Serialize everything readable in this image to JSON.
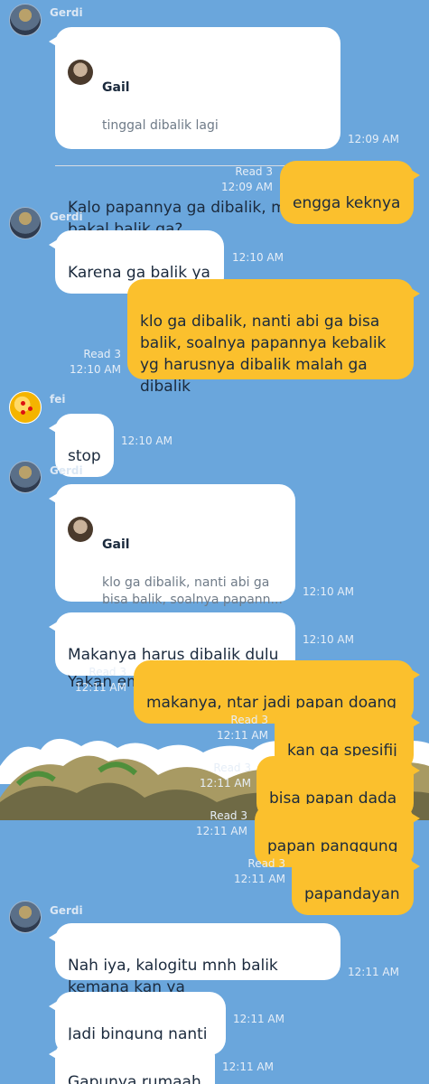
{
  "theme": {
    "background": "#6aa6dc",
    "incoming": "#ffffff",
    "outgoing": "#fbc02d"
  },
  "messages": [
    {
      "sender": "Gerdi",
      "quote_name": "Gail",
      "quote_text": "tinggal dibalik lagi",
      "text": "Kalo papannya ga dibalik, mnh\nbakal balik ga?",
      "time": "12:09 AM"
    },
    {
      "text": "engga keknya",
      "read": "Read 3",
      "time": "12:09 AM"
    },
    {
      "sender": "Gerdi",
      "text": "Karena ga balik ya",
      "time": "12:10 AM"
    },
    {
      "text": "klo ga dibalik, nanti abi ga bisa\nbalik, soalnya papannya kebalik\nyg harusnya dibalik malah ga\ndibalik",
      "read": "Read 3",
      "time": "12:10 AM"
    },
    {
      "sender": "fei",
      "text": "stop",
      "time": "12:10 AM"
    },
    {
      "sender": "Gerdi",
      "quote_name": "Gail",
      "quote_text": "klo ga dibalik, nanti abi ga\nbisa balik, soalnya papann...",
      "text": "Yakan emang sepenting itu",
      "time": "12:10 AM"
    },
    {
      "text": "Makanya harus dibalik dulu",
      "time": "12:10 AM"
    },
    {
      "text": "makanya, ntar jadi papan doang",
      "read": "Read 3",
      "time": "12:11 AM"
    },
    {
      "text": "kan ga spesifij",
      "read": "Read 3",
      "time": "12:11 AM"
    },
    {
      "text": "bisa papan dada",
      "read": "Read 3",
      "time": "12:11 AM"
    },
    {
      "text": "papan panggung",
      "read": "Read 3",
      "time": "12:11 AM"
    },
    {
      "text": "papandayan",
      "read": "Read 3",
      "time": "12:11 AM"
    },
    {
      "sender": "Gerdi",
      "text": "Nah iya, kalogitu mnh balik\nkemana kan ya",
      "time": "12:11 AM"
    },
    {
      "text": "Jadi bingung nanti",
      "time": "12:11 AM"
    },
    {
      "text": "Gapunya rumaah",
      "time": "12:11 AM"
    }
  ]
}
